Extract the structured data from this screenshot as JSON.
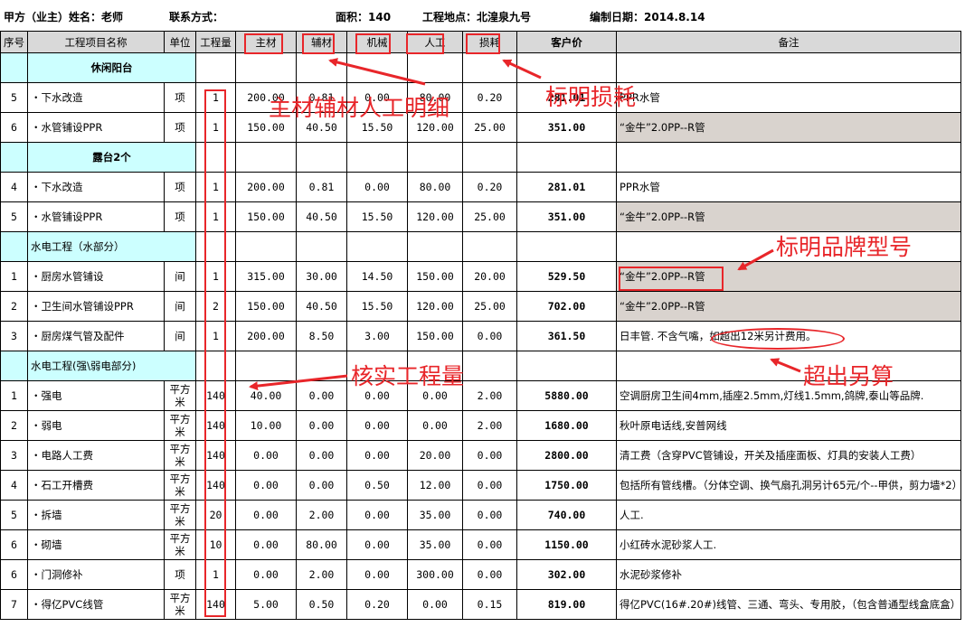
{
  "header": {
    "client": "甲方（业主）姓名：老师",
    "contact": "联系方式：",
    "area": "面积：140",
    "site": "工程地点：北湟泉九号",
    "date": "编制日期：2014.8.14"
  },
  "columns": [
    "序号",
    "工程项目名称",
    "单位",
    "工程量",
    "主材",
    "辅材",
    "机械",
    "人工",
    "损耗",
    "客户价",
    "备注"
  ],
  "rows": [
    {
      "type": "section",
      "style": "bold",
      "name": "休闲阳台"
    },
    {
      "type": "item",
      "no": "5",
      "name": "・下水改造",
      "unit": "项",
      "qty": "1",
      "main": "200.00",
      "aux": "0.81",
      "mach": "0.00",
      "labor": "80.00",
      "loss": "0.20",
      "price": "281.01",
      "note": "PPR水管",
      "gray": false
    },
    {
      "type": "item",
      "no": "6",
      "name": "・水管铺设PPR",
      "unit": "项",
      "qty": "1",
      "main": "150.00",
      "aux": "40.50",
      "mach": "15.50",
      "labor": "120.00",
      "loss": "25.00",
      "price": "351.00",
      "note": "“金牛”2.0PP--R管",
      "gray": true
    },
    {
      "type": "section",
      "style": "bold",
      "name": "露台2个"
    },
    {
      "type": "item",
      "no": "4",
      "name": "・下水改造",
      "unit": "项",
      "qty": "1",
      "main": "200.00",
      "aux": "0.81",
      "mach": "0.00",
      "labor": "80.00",
      "loss": "0.20",
      "price": "281.01",
      "note": "PPR水管",
      "gray": false
    },
    {
      "type": "item",
      "no": "5",
      "name": "・水管铺设PPR",
      "unit": "项",
      "qty": "1",
      "main": "150.00",
      "aux": "40.50",
      "mach": "15.50",
      "labor": "120.00",
      "loss": "25.00",
      "price": "351.00",
      "note": "“金牛”2.0PP--R管",
      "gray": true
    },
    {
      "type": "section",
      "style": "left",
      "name": "水电工程（水部分）"
    },
    {
      "type": "item",
      "no": "1",
      "name": "・厨房水管铺设",
      "unit": "间",
      "qty": "1",
      "main": "315.00",
      "aux": "30.00",
      "mach": "14.50",
      "labor": "150.00",
      "loss": "20.00",
      "price": "529.50",
      "note": "“金牛”2.0PP--R管",
      "gray": true
    },
    {
      "type": "item",
      "no": "2",
      "name": "・卫生间水管铺设PPR",
      "unit": "间",
      "qty": "2",
      "main": "150.00",
      "aux": "40.50",
      "mach": "15.50",
      "labor": "120.00",
      "loss": "25.00",
      "price": "702.00",
      "note": "“金牛”2.0PP--R管",
      "gray": true
    },
    {
      "type": "item",
      "no": "3",
      "name": "・厨房煤气管及配件",
      "unit": "间",
      "qty": "1",
      "main": "200.00",
      "aux": "8.50",
      "mach": "3.00",
      "labor": "150.00",
      "loss": "0.00",
      "price": "361.50",
      "note": "日丰管. 不含气嘴，如超出12米另计费用。",
      "gray": false
    },
    {
      "type": "section",
      "style": "left",
      "name": "水电工程(强\\弱电部分)"
    },
    {
      "type": "item",
      "no": "1",
      "name": "・强电",
      "unit": "平方米",
      "qty": "140",
      "main": "40.00",
      "aux": "0.00",
      "mach": "0.00",
      "labor": "0.00",
      "loss": "2.00",
      "price": "5880.00",
      "note": "空调厨房卫生间4mm,插座2.5mm,灯线1.5mm,鸽牌,泰山等品牌.",
      "gray": false
    },
    {
      "type": "item",
      "no": "2",
      "name": "・弱电",
      "unit": "平方米",
      "qty": "140",
      "main": "10.00",
      "aux": "0.00",
      "mach": "0.00",
      "labor": "0.00",
      "loss": "2.00",
      "price": "1680.00",
      "note": "秋叶原电话线,安普网线",
      "gray": false
    },
    {
      "type": "item",
      "no": "3",
      "name": "・电路人工费",
      "unit": "平方米",
      "qty": "140",
      "main": "0.00",
      "aux": "0.00",
      "mach": "0.00",
      "labor": "20.00",
      "loss": "0.00",
      "price": "2800.00",
      "note": "清工费（含穿PVC管铺设，开关及插座面板、灯具的安装人工费）",
      "gray": false
    },
    {
      "type": "item",
      "no": "4",
      "name": "・石工开槽费",
      "unit": "平方米",
      "qty": "140",
      "main": "0.00",
      "aux": "0.00",
      "mach": "0.50",
      "labor": "12.00",
      "loss": "0.00",
      "price": "1750.00",
      "note": "包括所有管线槽。（分体空调、换气扇孔洞另计65元/个--甲供，剪力墙*2）",
      "gray": false,
      "wrap": true
    },
    {
      "type": "item",
      "no": "5",
      "name": "・拆墙",
      "unit": "平方米",
      "qty": "20",
      "main": "0.00",
      "aux": "2.00",
      "mach": "0.00",
      "labor": "35.00",
      "loss": "0.00",
      "price": "740.00",
      "note": "人工.",
      "gray": false
    },
    {
      "type": "item",
      "no": "6",
      "name": "・砌墙",
      "unit": "平方米",
      "qty": "10",
      "main": "0.00",
      "aux": "80.00",
      "mach": "0.00",
      "labor": "35.00",
      "loss": "0.00",
      "price": "1150.00",
      "note": "小红砖水泥砂浆人工.",
      "gray": false
    },
    {
      "type": "item",
      "no": "6",
      "name": "・门洞修补",
      "unit": "项",
      "qty": "1",
      "main": "0.00",
      "aux": "2.00",
      "mach": "0.00",
      "labor": "300.00",
      "loss": "0.00",
      "price": "302.00",
      "note": "水泥砂浆修补",
      "gray": false
    },
    {
      "type": "item",
      "no": "7",
      "name": "・得亿PVC线管",
      "unit": "平方米",
      "qty": "140",
      "main": "5.00",
      "aux": "0.50",
      "mach": "0.20",
      "labor": "0.00",
      "loss": "0.15",
      "price": "819.00",
      "note": "得亿PVC(16#.20#)线管、三通、弯头、专用胶，（包含普通型线盒底盒）",
      "gray": false,
      "wrap": true
    }
  ],
  "annotations": {
    "main_aux_labor": "主材辅材人工明细",
    "loss": "标明损耗",
    "brand": "标明品牌型号",
    "verify_qty": "核实工程量",
    "extra": "超出另算"
  },
  "accent_color": "#e8262a"
}
